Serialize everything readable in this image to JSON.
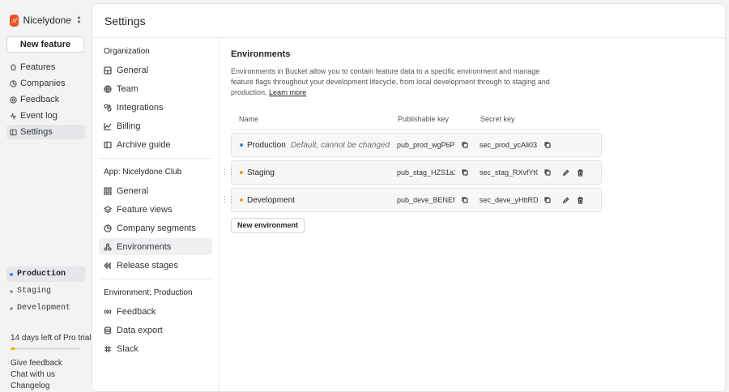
{
  "org": {
    "name": "Nicelydone Club",
    "logo_color": "#f0541e"
  },
  "sidebar": {
    "new_feature_label": "New feature",
    "items": [
      {
        "label": "Features",
        "icon": "features-icon"
      },
      {
        "label": "Companies",
        "icon": "companies-icon"
      },
      {
        "label": "Feedback",
        "icon": "feedback-icon"
      },
      {
        "label": "Event log",
        "icon": "event-log-icon"
      },
      {
        "label": "Settings",
        "icon": "settings-icon",
        "active": true
      }
    ],
    "environments": [
      {
        "label": "Production",
        "color": "#3b82f6",
        "active": true
      },
      {
        "label": "Staging",
        "color": "#9ca3af"
      },
      {
        "label": "Development",
        "color": "#9ca3af"
      }
    ],
    "trial": {
      "text": "14 days left of Pro trial",
      "progress_fraction": 0.07,
      "color": "#f0b400"
    },
    "bottom_links": [
      "Give feedback",
      "Chat with us",
      "Changelog"
    ]
  },
  "page": {
    "title": "Settings"
  },
  "settings_nav": {
    "organization": {
      "title": "Organization",
      "items": [
        "General",
        "Team",
        "Integrations",
        "Billing",
        "Archive guide"
      ]
    },
    "app": {
      "title": "App: Nicelydone Club",
      "items": [
        "General",
        "Feature views",
        "Company segments",
        "Environments",
        "Release stages"
      ],
      "active": "Environments"
    },
    "environment": {
      "title": "Environment: Production",
      "items": [
        "Feedback",
        "Data export",
        "Slack"
      ]
    }
  },
  "content": {
    "title": "Environments",
    "description": "Environments in Bucket allow you to contain feature data to a specific environment and manage feature flags throughout your development lifecycle, from local development through to staging and production.",
    "learn_more": "Learn more",
    "columns": {
      "name": "Name",
      "publishable": "Publishable key",
      "secret": "Secret key"
    },
    "rows": [
      {
        "name": "Production",
        "note": "Default, cannot be changed",
        "color": "#3b82f6",
        "publishable": "pub_prod_wgP6P…",
        "secret": "sec_prod_ycAli03…",
        "editable": false
      },
      {
        "name": "Staging",
        "note": "",
        "color": "#f59e0b",
        "publishable": "pub_stag_HZS1a1…",
        "secret": "sec_stag_RXvfYtG…",
        "editable": true
      },
      {
        "name": "Development",
        "note": "",
        "color": "#f59e0b",
        "publishable": "pub_deve_BENEfd…",
        "secret": "sec_deve_yHttRD…",
        "editable": true
      }
    ],
    "new_env_label": "New environment"
  }
}
